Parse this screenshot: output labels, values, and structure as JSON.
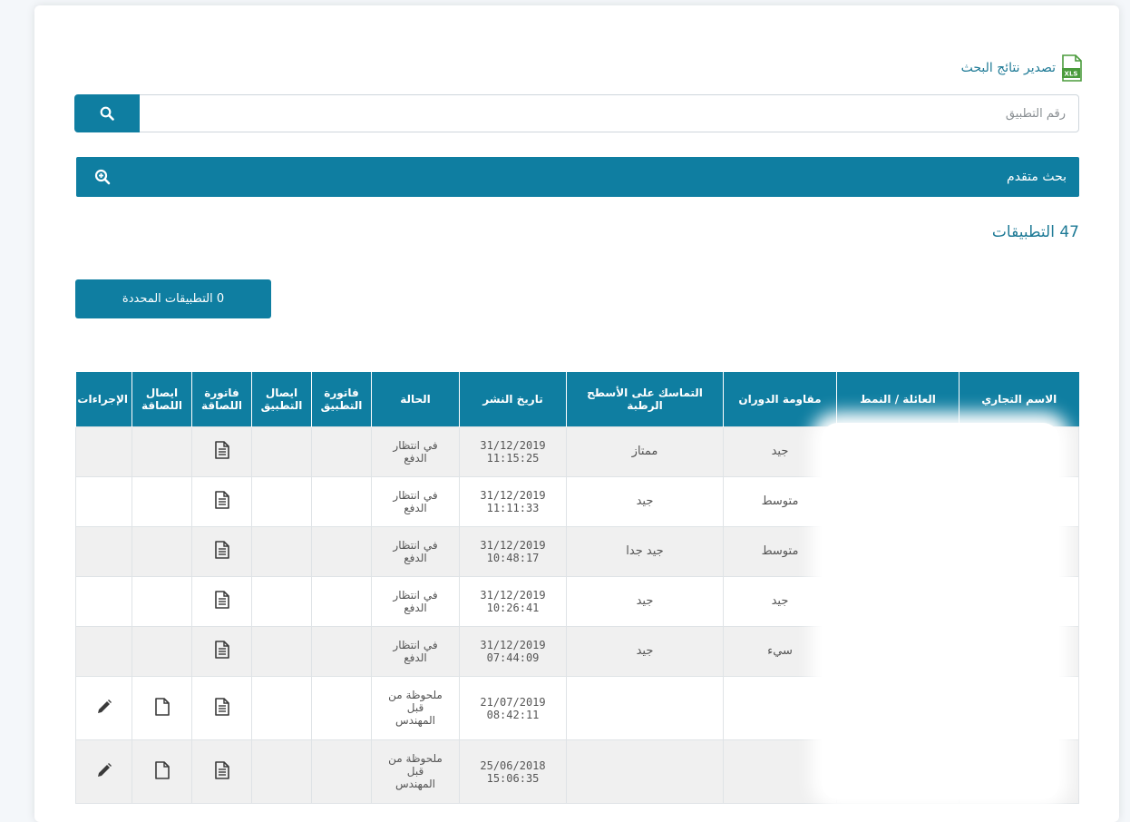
{
  "export": {
    "label": "تصدير نتائج البحث",
    "icon": "xls-file-icon",
    "icon_text": "XLS"
  },
  "search": {
    "placeholder": "رقم التطبيق",
    "value": "",
    "button_icon": "search-icon"
  },
  "advanced_search": {
    "label": "بحث متقدم",
    "icon": "zoom-in-icon"
  },
  "apps_count": "47 التطبيقات",
  "selected_button": "0 التطبيقات المحددة",
  "colors": {
    "primary": "#0f7ea1",
    "link": "#1e7a96",
    "row_alt": "#f0f0f0"
  },
  "table": {
    "headers": {
      "trade_name": "الاسم التجاري",
      "family": "العائلة / النمط",
      "rolling_resistance": "مقاومة الدوران",
      "wet_grip": "التماسك على الأسطح الرطبة",
      "publish_date": "تاريخ النشر",
      "status": "الحالة",
      "app_invoice": "فاتورة التطبيق",
      "app_receipt": "ايصال التطبيق",
      "label_invoice": "فاتورة اللصاقة",
      "label_receipt": "ايصال اللصاقة",
      "actions": "الإجراءات"
    },
    "rows": [
      {
        "rolling_resistance": "جيد",
        "wet_grip": "ممتاز",
        "date": "31/12/2019",
        "time": "11:15:25",
        "status": "في انتظار الدفع"
      },
      {
        "rolling_resistance": "متوسط",
        "wet_grip": "جيد",
        "date": "31/12/2019",
        "time": "11:11:33",
        "status": "في انتظار الدفع"
      },
      {
        "rolling_resistance": "متوسط",
        "wet_grip": "جيد جدا",
        "date": "31/12/2019",
        "time": "10:48:17",
        "status": "في انتظار الدفع"
      },
      {
        "rolling_resistance": "جيد",
        "wet_grip": "جيد",
        "date": "31/12/2019",
        "time": "10:26:41",
        "status": "في انتظار الدفع"
      },
      {
        "rolling_resistance": "سيء",
        "wet_grip": "جيد",
        "date": "31/12/2019",
        "time": "07:44:09",
        "status": "في انتظار الدفع"
      },
      {
        "rolling_resistance": "",
        "wet_grip": "",
        "date": "21/07/2019",
        "time": "08:42:11",
        "status": "ملحوظة من قبل المهندس"
      },
      {
        "rolling_resistance": "",
        "wet_grip": "",
        "date": "25/06/2018",
        "time": "15:06:35",
        "status": "ملحوظة من قبل المهندس"
      }
    ],
    "row_icons": {
      "label_invoice": "document-icon",
      "label_receipt": "blank-file-icon",
      "actions": "edit-pencil-icon"
    }
  }
}
